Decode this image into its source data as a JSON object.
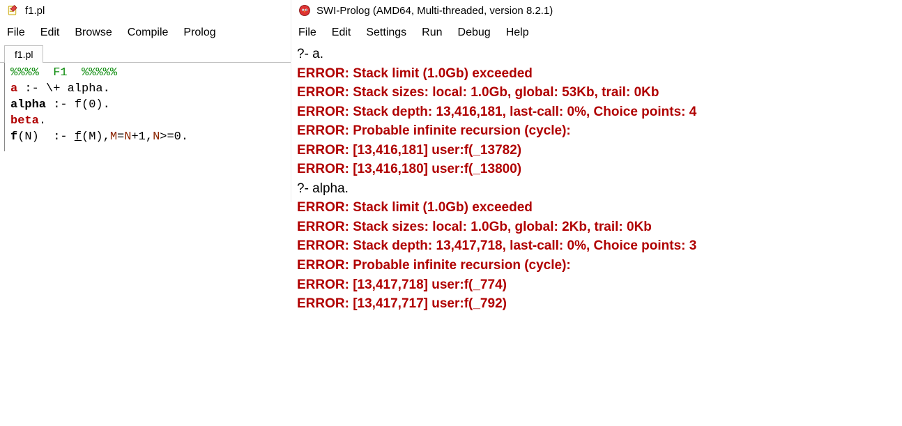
{
  "editor": {
    "title": "f1.pl",
    "menus": [
      "File",
      "Edit",
      "Browse",
      "Compile",
      "Prolog"
    ],
    "tab": "f1.pl",
    "code": {
      "l1_comment": "%%%%  F1  %%%%%",
      "l2_a": "a",
      "l2_rest": " :- \\+ alpha.",
      "l3_alpha": "alpha",
      "l3_rest": " :- f(0).",
      "l4_beta": "beta",
      "l4_dot": ".",
      "l5_f": "f",
      "l5_open": "(N)  :- ",
      "l5_fcall": "f",
      "l5_argsA": "(M),",
      "l5_m": "M",
      "l5_eq": "=",
      "l5_n1": "N",
      "l5_plus": "+1,",
      "l5_n2": "N",
      "l5_ge": ">=0."
    }
  },
  "console": {
    "title": "SWI-Prolog (AMD64, Multi-threaded, version 8.2.1)",
    "menus": [
      "File",
      "Edit",
      "Settings",
      "Run",
      "Debug",
      "Help"
    ],
    "lines": [
      {
        "cls": "query-line",
        "text": "?- a."
      },
      {
        "cls": "error-line",
        "text": "ERROR: Stack limit (1.0Gb) exceeded"
      },
      {
        "cls": "error-line",
        "text": "ERROR:   Stack sizes: local: 1.0Gb, global: 53Kb, trail: 0Kb"
      },
      {
        "cls": "error-line",
        "text": "ERROR:   Stack depth: 13,416,181, last-call: 0%, Choice points: 4"
      },
      {
        "cls": "error-line",
        "text": "ERROR:   Probable infinite recursion (cycle):"
      },
      {
        "cls": "error-line",
        "text": "ERROR:     [13,416,181] user:f(_13782)"
      },
      {
        "cls": "error-line",
        "text": "ERROR:     [13,416,180] user:f(_13800)"
      },
      {
        "cls": "query-line",
        "text": "?- alpha."
      },
      {
        "cls": "error-line",
        "text": "ERROR: Stack limit (1.0Gb) exceeded"
      },
      {
        "cls": "error-line",
        "text": "ERROR:   Stack sizes: local: 1.0Gb, global: 2Kb, trail: 0Kb"
      },
      {
        "cls": "error-line",
        "text": "ERROR:   Stack depth: 13,417,718, last-call: 0%, Choice points: 3"
      },
      {
        "cls": "error-line",
        "text": "ERROR:   Probable infinite recursion (cycle):"
      },
      {
        "cls": "error-line",
        "text": "ERROR:     [13,417,718] user:f(_774)"
      },
      {
        "cls": "error-line",
        "text": "ERROR:     [13,417,717] user:f(_792)"
      }
    ]
  }
}
